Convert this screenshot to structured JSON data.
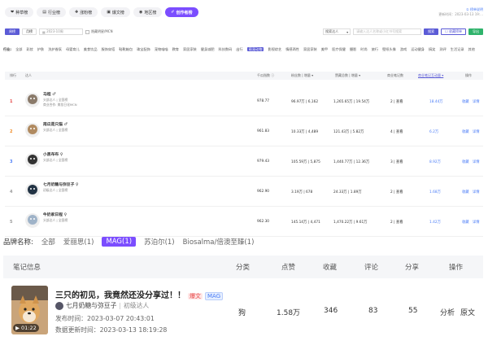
{
  "tabs": [
    {
      "icon": "❤",
      "label": "种草榜",
      "active": false
    },
    {
      "icon": "▤",
      "label": "行业榜",
      "active": false
    },
    {
      "icon": "✚",
      "label": "涨粉榜",
      "active": false
    },
    {
      "icon": "▣",
      "label": "爆文榜",
      "active": false
    },
    {
      "icon": "◉",
      "label": "地区榜",
      "active": false
    },
    {
      "icon": "✐",
      "label": "创作者榜",
      "active": true
    }
  ],
  "update": {
    "link": "① 榜单说明",
    "time": "更新时间：2023-03-13 19:..."
  },
  "filters": {
    "week": "周榜",
    "month": "月榜",
    "date_placeholder": "2023-10周",
    "checkbox_label": "隐藏明星/MCN",
    "select_value": "搜索达人",
    "search_placeholder": "请输入达人名称或小红书号搜索",
    "search_button": "搜索",
    "fav_button": "☐ 收藏榜单",
    "export_button": "导出"
  },
  "industry": {
    "label": "行业:",
    "items": [
      "全部",
      "彩妆",
      "护肤",
      "洗护香氛",
      "母婴育儿",
      "美食饮品",
      "服饰穿搭",
      "鞋靴箱包",
      "珠宝配饰",
      "宠物喵喵",
      "教育",
      "家居家装",
      "健身减肥",
      "科技数码",
      "出行",
      "萌宠动物",
      "影视综艺",
      "情感两性",
      "家居家装",
      "美甲",
      "医疗保健",
      "摄影",
      "时尚",
      "旅行",
      "壁纸头像",
      "游戏",
      "运动健身",
      "搞笑",
      "测评",
      "生活记录",
      "其他"
    ],
    "active": "萌宠动物"
  },
  "table": {
    "headers": [
      "排行",
      "达人",
      "千瓜指数 ⓘ",
      "粉丝数 | 增量 ▾",
      "赞藏总数 | 增量 ▾",
      "商业笔记数",
      "商业笔记互动量 ▾",
      "操作"
    ],
    "rows": [
      {
        "rank": "1",
        "name": "马程 ♂",
        "sub1": "头部达人 | 全国榜",
        "sub2": "商业合作: 美妆日化MCN",
        "index": "978.77",
        "fans": "96.97万 | 6,162",
        "likes": "1,265.65万 | 19.54万",
        "notes": "2 | 查看",
        "inter": "18.44万",
        "act1": "收藏",
        "act2": "详情",
        "rank_color": "#e54646",
        "av": "#8a7a6a"
      },
      {
        "rank": "2",
        "name": "南瓜是只猫 ♂",
        "sub1": "头部达人 | 全国榜",
        "sub2": "",
        "index": "961.83",
        "fans": "10.33万 | 4,489",
        "likes": "121.43万 | 5.82万",
        "notes": "4 | 查看",
        "inter": "6.2万",
        "act1": "收藏",
        "act2": "详情",
        "rank_color": "#f08a24",
        "av": "#b08a60"
      },
      {
        "rank": "3",
        "name": "小黑布布 ♀",
        "sub1": "头部达人 | 全国榜",
        "sub2": "",
        "index": "979.43",
        "fans": "105.59万 | 5,875",
        "likes": "1,440.77万 | 12.36万",
        "notes": "3 | 查看",
        "inter": "8.92万",
        "act1": "收藏",
        "act2": "详情",
        "rank_color": "#4a7cf7",
        "av": "#333333"
      },
      {
        "rank": "4",
        "name": "七月奶糖与弥豆子 ♀",
        "sub1": "初级达人 | 全国榜",
        "sub2": "",
        "index": "962.90",
        "fans": "3.19万 | 678",
        "likes": "24.33万 | 1.89万",
        "notes": "2 | 查看",
        "inter": "1.68万",
        "act1": "收藏",
        "act2": "详情",
        "rank_color": "#999999",
        "av": "#223344"
      },
      {
        "rank": "5",
        "name": "牛奶家日程 ♀",
        "sub1": "头部达人 | 全国榜",
        "sub2": "",
        "index": "962.30",
        "fans": "145.14万 | 4,471",
        "likes": "1,470.22万 | 9.61万",
        "notes": "2 | 查看",
        "inter": "1.42万",
        "act1": "收藏",
        "act2": "详情",
        "rank_color": "#999999",
        "av": "#9fb3c8"
      }
    ]
  },
  "brand": {
    "label": "品牌名称:",
    "items": [
      "全部",
      "爱丽思(1)",
      "MAG(1)",
      "苏泊尔(1)",
      "Biosalma/倍澳至臻(1)"
    ],
    "active": "MAG(1)"
  },
  "notes_header": [
    "笔记信息",
    "分类",
    "点赞",
    "收藏",
    "评论",
    "分享",
    "操作"
  ],
  "note": {
    "title": "三只的初见，我竟然还没分享过！！",
    "tag1": "爆文",
    "tag2": "MAG",
    "author": "七月奶糖与弥豆子",
    "level": "初级达人",
    "publish": "发布时间：2023-03-07 20:43:01",
    "updated": "数据更新时间：2023-03-13 18:19:28",
    "duration": "01:22",
    "category": "狗",
    "likes": "1.58万",
    "collects": "346",
    "comments": "83",
    "shares": "55",
    "act1": "分析",
    "act2": "原文"
  }
}
